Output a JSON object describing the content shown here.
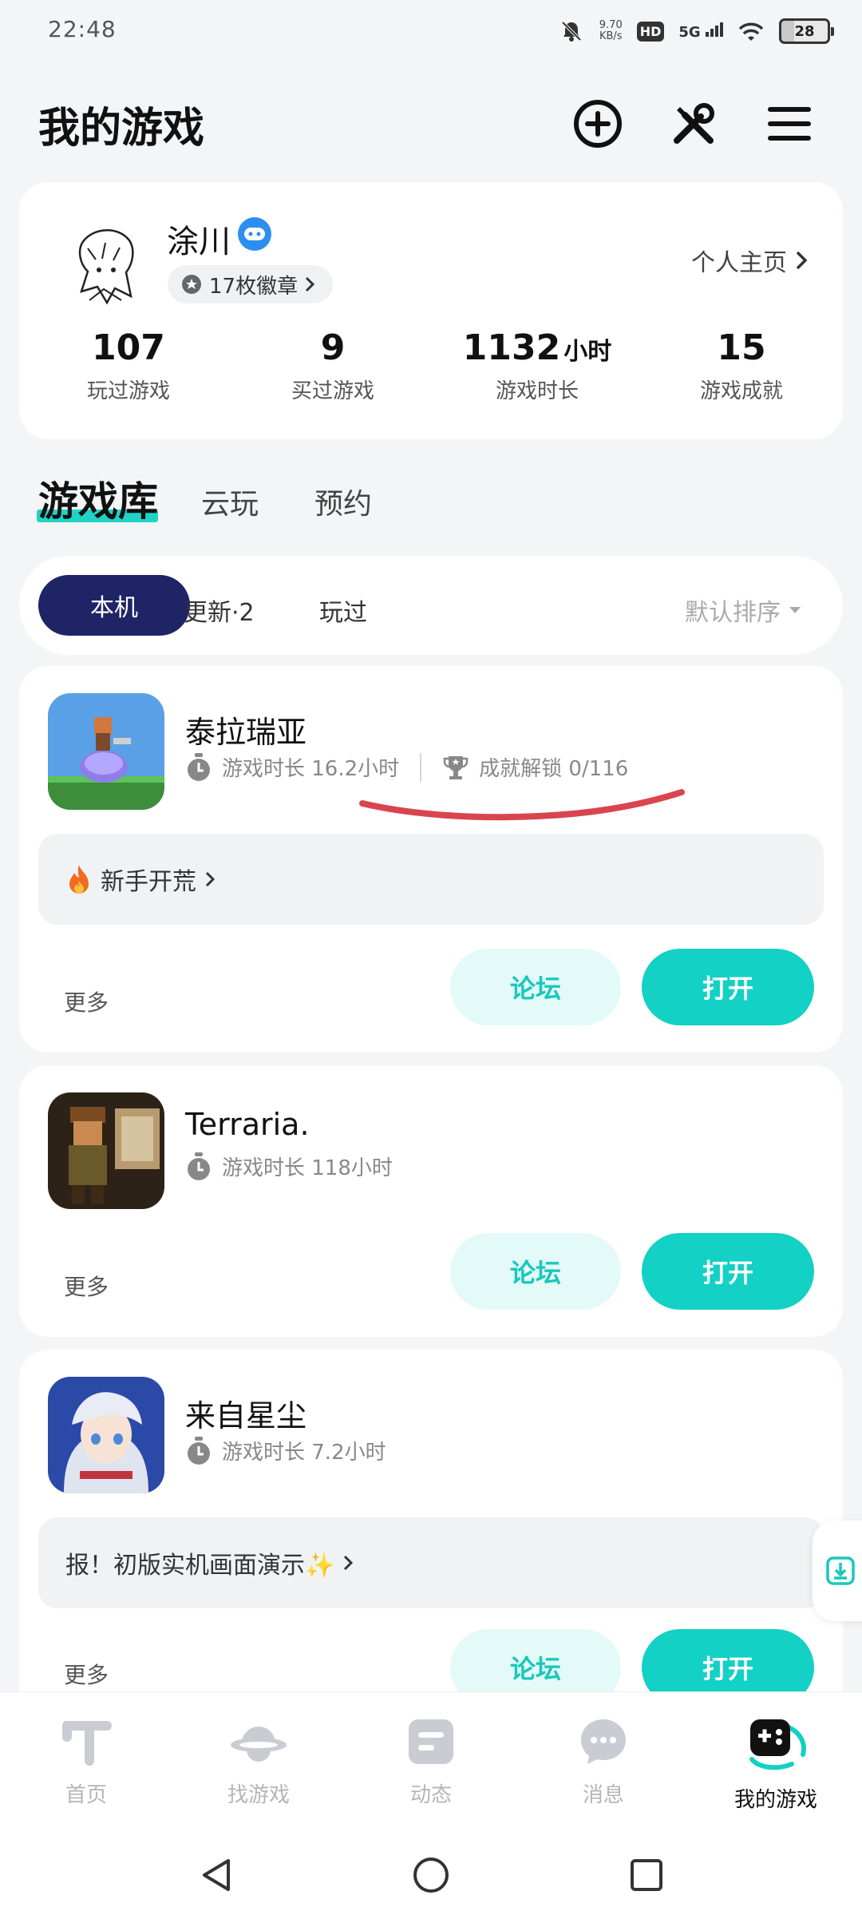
{
  "status_bar": {
    "time": "22:48",
    "speed_value": "9.70",
    "speed_unit": "KB/s",
    "hd_label": "HD",
    "network_label": "5G",
    "battery": "28"
  },
  "header": {
    "title": "我的游戏",
    "icons": [
      "add-circle-icon",
      "tools-icon",
      "menu-icon"
    ]
  },
  "profile": {
    "username": "涂川",
    "badges_label": "17枚徽章",
    "profile_link": "个人主页",
    "stats": [
      {
        "value": "107",
        "unit": "",
        "label": "玩过游戏"
      },
      {
        "value": "9",
        "unit": "",
        "label": "买过游戏"
      },
      {
        "value": "1132",
        "unit": "小时",
        "label": "游戏时长"
      },
      {
        "value": "15",
        "unit": "",
        "label": "游戏成就"
      }
    ]
  },
  "main_tabs": [
    "游戏库",
    "云玩",
    "预约"
  ],
  "filters": {
    "chips": [
      "本机",
      "更新·2",
      "玩过"
    ],
    "sort_label": "默认排序"
  },
  "games": [
    {
      "name": "泰拉瑞亚",
      "playtime": "游戏时长 16.2小时",
      "achievements": "成就解锁 0/116",
      "promo": "新手开荒",
      "more": "更多",
      "forum": "论坛",
      "open": "打开"
    },
    {
      "name": "Terraria.",
      "playtime": "游戏时长 118小时",
      "more": "更多",
      "forum": "论坛",
      "open": "打开"
    },
    {
      "name": "来自星尘",
      "playtime": "游戏时长 7.2小时",
      "promo": "报！初版实机画面演示✨",
      "more": "更多",
      "forum": "论坛",
      "open": "打开"
    }
  ],
  "bottom_nav": [
    {
      "label": "首页",
      "icon": "home-icon"
    },
    {
      "label": "找游戏",
      "icon": "planet-icon"
    },
    {
      "label": "动态",
      "icon": "feed-icon"
    },
    {
      "label": "消息",
      "icon": "message-icon"
    },
    {
      "label": "我的游戏",
      "icon": "gamepad-icon",
      "active": true
    }
  ],
  "colors": {
    "accent": "#13d1c4",
    "chip_active": "#1f2466",
    "annotation": "#d9454f"
  }
}
